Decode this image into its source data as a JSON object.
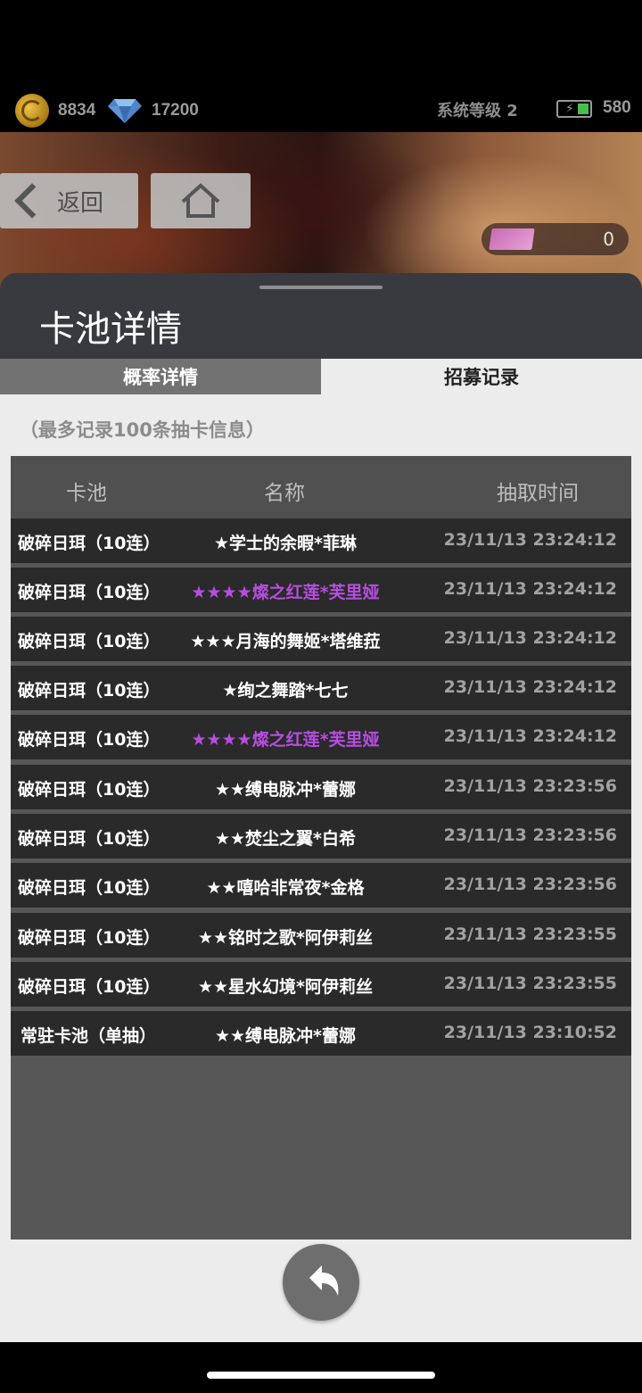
{
  "resources": {
    "gold": "8834",
    "diamond": "17200",
    "system_level": "系统等级 2",
    "energy": "580"
  },
  "nav": {
    "back_label": "返回",
    "ticket_count": "0"
  },
  "sheet": {
    "title": "卡池详情",
    "tabs": [
      {
        "label": "概率详情",
        "active": false
      },
      {
        "label": "招募记录",
        "active": true
      }
    ],
    "note": "（最多记录100条抽卡信息）"
  },
  "table": {
    "headers": [
      "卡池",
      "名称",
      "抽取时间"
    ],
    "rows": [
      {
        "pool": "破碎日珥（10连）",
        "name": "★学士的余暇*菲琳",
        "time": "23/11/13 23:24:12",
        "highlight": false
      },
      {
        "pool": "破碎日珥（10连）",
        "name": "★★★★燦之红莲*芙里娅",
        "time": "23/11/13 23:24:12",
        "highlight": true
      },
      {
        "pool": "破碎日珥（10连）",
        "name": "★★★月海的舞姬*塔维菈",
        "time": "23/11/13 23:24:12",
        "highlight": false
      },
      {
        "pool": "破碎日珥（10连）",
        "name": "★绚之舞踏*七七",
        "time": "23/11/13 23:24:12",
        "highlight": false
      },
      {
        "pool": "破碎日珥（10连）",
        "name": "★★★★燦之红莲*芙里娅",
        "time": "23/11/13 23:24:12",
        "highlight": true
      },
      {
        "pool": "破碎日珥（10连）",
        "name": "★★缚电脉冲*蕾娜",
        "time": "23/11/13 23:23:56",
        "highlight": false
      },
      {
        "pool": "破碎日珥（10连）",
        "name": "★★焚尘之翼*白希",
        "time": "23/11/13 23:23:56",
        "highlight": false
      },
      {
        "pool": "破碎日珥（10连）",
        "name": "★★嘻哈非常夜*金格",
        "time": "23/11/13 23:23:56",
        "highlight": false
      },
      {
        "pool": "破碎日珥（10连）",
        "name": "★★铭时之歌*阿伊莉丝",
        "time": "23/11/13 23:23:55",
        "highlight": false
      },
      {
        "pool": "破碎日珥（10连）",
        "name": "★★星水幻境*阿伊莉丝",
        "time": "23/11/13 23:23:55",
        "highlight": false
      },
      {
        "pool": "常驻卡池（单抽）",
        "name": "★★缚电脉冲*蕾娜",
        "time": "23/11/13 23:10:52",
        "highlight": false
      }
    ]
  },
  "colors": {
    "highlight_purple": "#b64ee0",
    "row_bg": "#2a2a2a",
    "tab_inactive": "#727272"
  },
  "icons": [
    "gold-coin-icon",
    "diamond-icon",
    "battery-icon",
    "chevron-left-icon",
    "home-icon",
    "ticket-card-icon",
    "undo-icon"
  ]
}
